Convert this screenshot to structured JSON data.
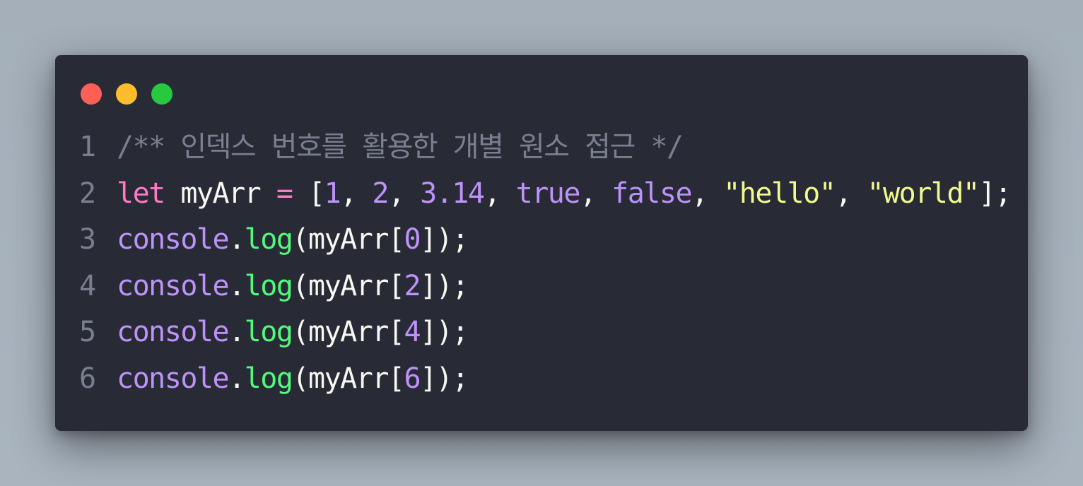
{
  "window": {
    "controls": [
      {
        "name": "close",
        "color": "#ff5f56"
      },
      {
        "name": "minimize",
        "color": "#ffbd2e"
      },
      {
        "name": "maximize",
        "color": "#27c93f"
      }
    ]
  },
  "code": {
    "lines": [
      {
        "number": "1",
        "tokens": [
          {
            "text": "/** 인덱스 번호를 활용한 개별 원소 접근 */",
            "type": "comment"
          }
        ]
      },
      {
        "number": "2",
        "tokens": [
          {
            "text": "let",
            "type": "keyword"
          },
          {
            "text": " myArr ",
            "type": "ident"
          },
          {
            "text": "=",
            "type": "op"
          },
          {
            "text": " [",
            "type": "punc"
          },
          {
            "text": "1",
            "type": "number"
          },
          {
            "text": ", ",
            "type": "punc"
          },
          {
            "text": "2",
            "type": "number"
          },
          {
            "text": ", ",
            "type": "punc"
          },
          {
            "text": "3.14",
            "type": "number"
          },
          {
            "text": ", ",
            "type": "punc"
          },
          {
            "text": "true",
            "type": "bool"
          },
          {
            "text": ", ",
            "type": "punc"
          },
          {
            "text": "false",
            "type": "bool"
          },
          {
            "text": ", ",
            "type": "punc"
          },
          {
            "text": "\"hello\"",
            "type": "string"
          },
          {
            "text": ", ",
            "type": "punc"
          },
          {
            "text": "\"world\"",
            "type": "string"
          },
          {
            "text": "];",
            "type": "punc"
          }
        ]
      },
      {
        "number": "3",
        "tokens": [
          {
            "text": "console",
            "type": "object"
          },
          {
            "text": ".",
            "type": "punc"
          },
          {
            "text": "log",
            "type": "method"
          },
          {
            "text": "(myArr[",
            "type": "punc"
          },
          {
            "text": "0",
            "type": "number"
          },
          {
            "text": "]);",
            "type": "punc"
          }
        ]
      },
      {
        "number": "4",
        "tokens": [
          {
            "text": "console",
            "type": "object"
          },
          {
            "text": ".",
            "type": "punc"
          },
          {
            "text": "log",
            "type": "method"
          },
          {
            "text": "(myArr[",
            "type": "punc"
          },
          {
            "text": "2",
            "type": "number"
          },
          {
            "text": "]);",
            "type": "punc"
          }
        ]
      },
      {
        "number": "5",
        "tokens": [
          {
            "text": "console",
            "type": "object"
          },
          {
            "text": ".",
            "type": "punc"
          },
          {
            "text": "log",
            "type": "method"
          },
          {
            "text": "(myArr[",
            "type": "punc"
          },
          {
            "text": "4",
            "type": "number"
          },
          {
            "text": "]);",
            "type": "punc"
          }
        ]
      },
      {
        "number": "6",
        "tokens": [
          {
            "text": "console",
            "type": "object"
          },
          {
            "text": ".",
            "type": "punc"
          },
          {
            "text": "log",
            "type": "method"
          },
          {
            "text": "(myArr[",
            "type": "punc"
          },
          {
            "text": "6",
            "type": "number"
          },
          {
            "text": "]);",
            "type": "punc"
          }
        ]
      }
    ]
  }
}
